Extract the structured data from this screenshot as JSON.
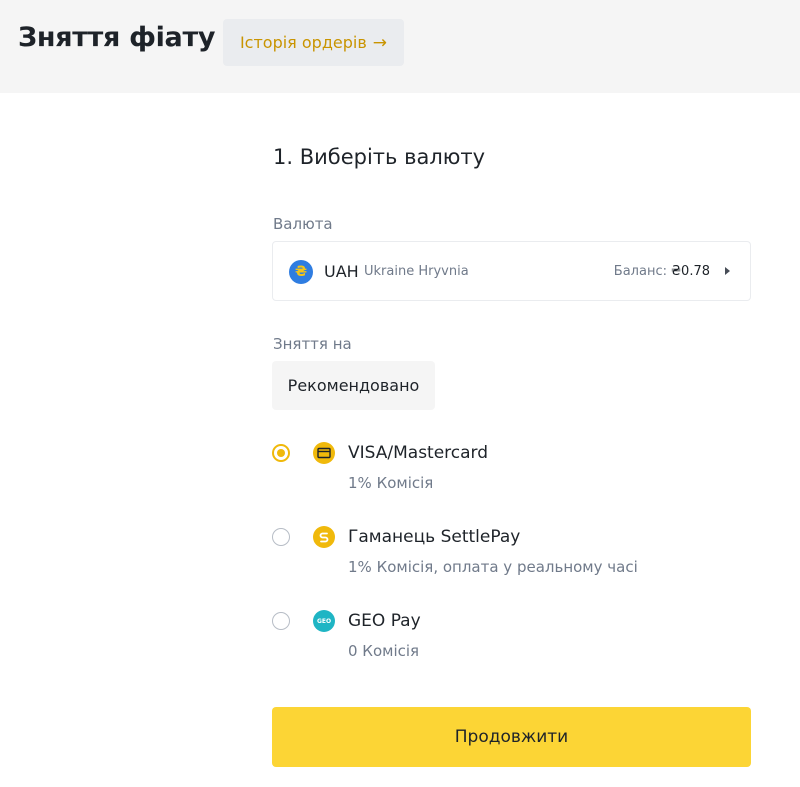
{
  "header": {
    "title": "Зняття фіату",
    "history_label": "Історія ордерів",
    "history_arrow": "→"
  },
  "step": {
    "title": "1. Виберіть валюту"
  },
  "currency": {
    "label": "Валюта",
    "icon_glyph": "₴",
    "code": "UAH",
    "name": "Ukraine Hryvnia",
    "balance_label": "Баланс:",
    "balance_value": "₴0.78"
  },
  "withdraw_to": {
    "label": "Зняття на",
    "tab_label": "Рекомендовано"
  },
  "methods": [
    {
      "name": "VISA/Mastercard",
      "fee": "1% Комісія",
      "selected": true,
      "icon": "card-icon",
      "color": "#f0b90b"
    },
    {
      "name": "Гаманець SettlePay",
      "fee": "1% Комісія, оплата у реальному часі",
      "selected": false,
      "icon": "settlepay-icon",
      "color": "#f0b90b"
    },
    {
      "name": "GEO Pay",
      "fee": "0 Комісія",
      "selected": false,
      "icon": "geopay-icon",
      "color": "#1fb5c4"
    }
  ],
  "geopay_icon_text": "GEO",
  "actions": {
    "continue_label": "Продовжити"
  },
  "colors": {
    "accent": "#f0b90b",
    "button": "#fcd535",
    "link": "#c99400"
  }
}
